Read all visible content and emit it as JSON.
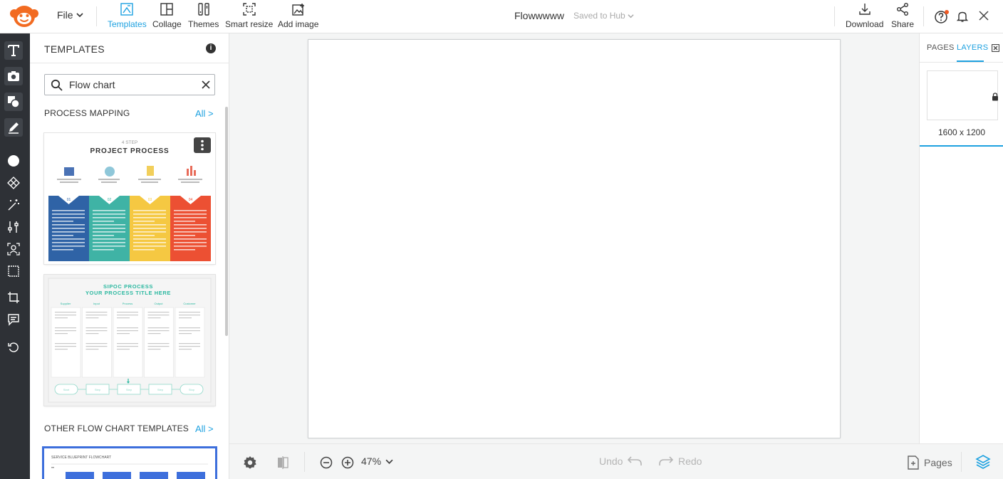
{
  "topbar": {
    "file_label": "File",
    "tools": [
      {
        "label": "Templates",
        "active": true
      },
      {
        "label": "Collage",
        "active": false
      },
      {
        "label": "Themes",
        "active": false
      },
      {
        "label": "Smart resize",
        "active": false
      },
      {
        "label": "Add image",
        "active": false
      }
    ],
    "doc_title": "Flowwwww",
    "save_status": "Saved to Hub",
    "download_label": "Download",
    "share_label": "Share"
  },
  "colors": {
    "accent": "#1da1e0",
    "rail_bg": "#2e3136",
    "notification_dot": "#f15a24",
    "logo": "#f26b21"
  },
  "panel": {
    "title": "TEMPLATES",
    "search_value": "Flow chart",
    "sections": [
      {
        "title": "PROCESS MAPPING",
        "all_label": "All >"
      },
      {
        "title": "OTHER FLOW CHART TEMPLATES",
        "all_label": "All >"
      }
    ],
    "templates": [
      {
        "kicker": "4 STEP",
        "title": "PROJECT PROCESS",
        "step_numbers": [
          "01",
          "02",
          "03",
          "04"
        ],
        "step_colors": [
          "#2f63a6",
          "#3fb3a5",
          "#f5c842",
          "#ec5033"
        ]
      },
      {
        "title_line1": "SIPOC PROCESS",
        "title_line2": "YOUR PROCESS TITLE HERE",
        "columns": [
          "Supplier",
          "Input",
          "Process",
          "Output",
          "Customer"
        ],
        "flow_nodes": [
          "Start",
          "Step",
          "Step",
          "Step",
          "Stop"
        ]
      },
      {
        "title": "SERVICE BLUEPRINT FLOWCHART"
      }
    ]
  },
  "canvas": {
    "zoom": "47%",
    "undo_label": "Undo",
    "redo_label": "Redo",
    "pages_label": "Pages"
  },
  "right_panel": {
    "tabs": [
      {
        "label": "PAGES",
        "active": false
      },
      {
        "label": "LAYERS",
        "active": true
      }
    ],
    "page_size": "1600 x 1200"
  },
  "icons": {
    "rail": [
      "text-icon",
      "camera-icon",
      "shapes-icon",
      "draw-icon",
      "circle-icon",
      "texture-icon",
      "magic-wand-icon",
      "adjust-icon",
      "face-icon",
      "frame-icon",
      "crop-icon",
      "comment-icon",
      "history-icon"
    ]
  }
}
